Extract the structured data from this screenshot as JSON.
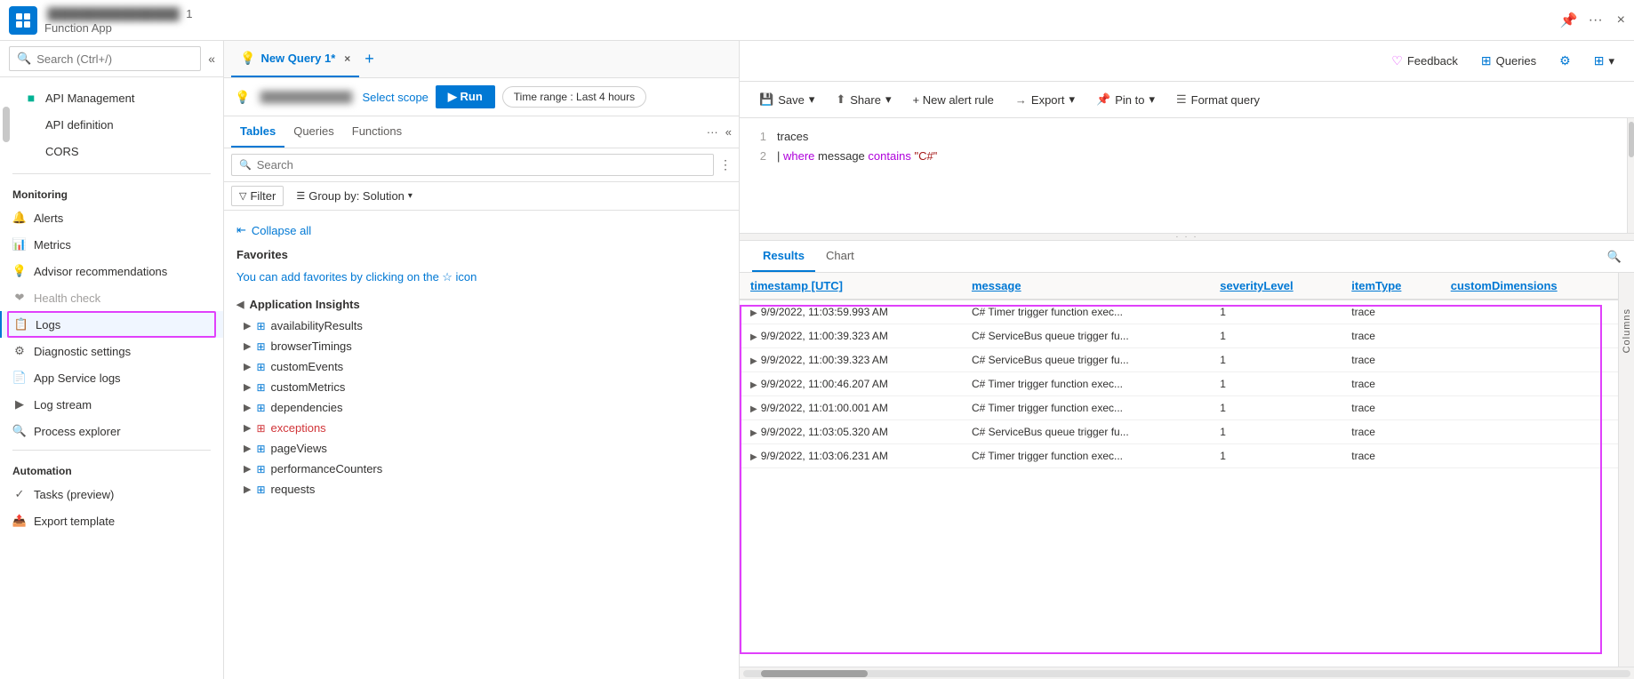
{
  "app": {
    "title": "Function App",
    "top_number": "1",
    "close_label": "×"
  },
  "top_bar": {
    "feedback_label": "Feedback",
    "queries_label": "Queries",
    "settings_icon": "⚙",
    "expand_icon": "⊞"
  },
  "sidebar": {
    "search_placeholder": "Search (Ctrl+/)",
    "collapse_icon": "«",
    "items": [
      {
        "id": "api-management",
        "label": "API Management",
        "icon": "🟩"
      },
      {
        "id": "api-definition",
        "label": "API definition",
        "icon": ""
      },
      {
        "id": "cors",
        "label": "CORS",
        "icon": ""
      }
    ],
    "monitoring_section": "Monitoring",
    "monitoring_items": [
      {
        "id": "alerts",
        "label": "Alerts",
        "icon": "🔔"
      },
      {
        "id": "metrics",
        "label": "Metrics",
        "icon": "📊"
      },
      {
        "id": "advisor",
        "label": "Advisor recommendations",
        "icon": "💡"
      },
      {
        "id": "health-check",
        "label": "Health check",
        "icon": "❤"
      },
      {
        "id": "logs",
        "label": "Logs",
        "icon": "📋",
        "active": true
      },
      {
        "id": "diagnostic",
        "label": "Diagnostic settings",
        "icon": "⚙"
      },
      {
        "id": "app-service-logs",
        "label": "App Service logs",
        "icon": "📄"
      },
      {
        "id": "log-stream",
        "label": "Log stream",
        "icon": "▶"
      },
      {
        "id": "process-explorer",
        "label": "Process explorer",
        "icon": "🔍"
      }
    ],
    "automation_section": "Automation",
    "automation_items": [
      {
        "id": "tasks",
        "label": "Tasks (preview)",
        "icon": "✓"
      },
      {
        "id": "export-template",
        "label": "Export template",
        "icon": "📤"
      }
    ]
  },
  "query_panel": {
    "tab_label": "New Query 1*",
    "tab_close": "×",
    "tab_add": "+",
    "scope_label_blurred": "████████████",
    "select_scope": "Select scope",
    "run_label": "▶ Run",
    "time_range": "Time range : Last 4 hours",
    "save_label": "Save",
    "share_label": "Share",
    "new_alert_label": "+ New alert rule",
    "export_label": "Export",
    "pin_to_label": "Pin to",
    "format_query_label": "Format query"
  },
  "left_panel": {
    "tabs": [
      {
        "id": "tables",
        "label": "Tables",
        "active": true
      },
      {
        "id": "queries",
        "label": "Queries"
      },
      {
        "id": "functions",
        "label": "Functions"
      }
    ],
    "more_icon": "···",
    "search_placeholder": "Search",
    "filter_label": "Filter",
    "group_by_label": "Group by: Solution",
    "collapse_all_label": "Collapse all",
    "favorites_title": "Favorites",
    "favorites_desc": "You can add favorites by clicking on the",
    "favorites_icon_hint": "☆",
    "favorites_desc2": "icon",
    "app_insights_label": "Application Insights",
    "tables": [
      "availabilityResults",
      "browserTimings",
      "customEvents",
      "customMetrics",
      "dependencies",
      "exceptions",
      "pageViews",
      "performanceCounters",
      "requests"
    ]
  },
  "code_editor": {
    "lines": [
      {
        "num": "1",
        "content": "traces"
      },
      {
        "num": "2",
        "content": "| where message contains \"C#\""
      }
    ]
  },
  "results": {
    "tabs": [
      {
        "id": "results",
        "label": "Results",
        "active": true
      },
      {
        "id": "chart",
        "label": "Chart"
      }
    ],
    "columns": [
      {
        "id": "timestamp",
        "label": "timestamp [UTC]"
      },
      {
        "id": "message",
        "label": "message"
      },
      {
        "id": "severity",
        "label": "severityLevel"
      },
      {
        "id": "item-type",
        "label": "itemType"
      },
      {
        "id": "custom-dims",
        "label": "customDimensions"
      }
    ],
    "rows": [
      {
        "timestamp": "9/9/2022, 11:03:59.993 AM",
        "message": "C# Timer trigger function exec...",
        "severity": "1",
        "item_type": "trace",
        "custom_dims": ""
      },
      {
        "timestamp": "9/9/2022, 11:00:39.323 AM",
        "message": "C# ServiceBus queue trigger fu...",
        "severity": "1",
        "item_type": "trace",
        "custom_dims": ""
      },
      {
        "timestamp": "9/9/2022, 11:00:39.323 AM",
        "message": "C# ServiceBus queue trigger fu...",
        "severity": "1",
        "item_type": "trace",
        "custom_dims": ""
      },
      {
        "timestamp": "9/9/2022, 11:00:46.207 AM",
        "message": "C# Timer trigger function exec...",
        "severity": "1",
        "item_type": "trace",
        "custom_dims": ""
      },
      {
        "timestamp": "9/9/2022, 11:01:00.001 AM",
        "message": "C# Timer trigger function exec...",
        "severity": "1",
        "item_type": "trace",
        "custom_dims": ""
      },
      {
        "timestamp": "9/9/2022, 11:03:05.320 AM",
        "message": "C# ServiceBus queue trigger fu...",
        "severity": "1",
        "item_type": "trace",
        "custom_dims": ""
      },
      {
        "timestamp": "9/9/2022, 11:03:06.231 AM",
        "message": "C# Timer trigger function exec...",
        "severity": "1",
        "item_type": "trace",
        "custom_dims": ""
      }
    ],
    "columns_sidebar_label": "Columns"
  }
}
